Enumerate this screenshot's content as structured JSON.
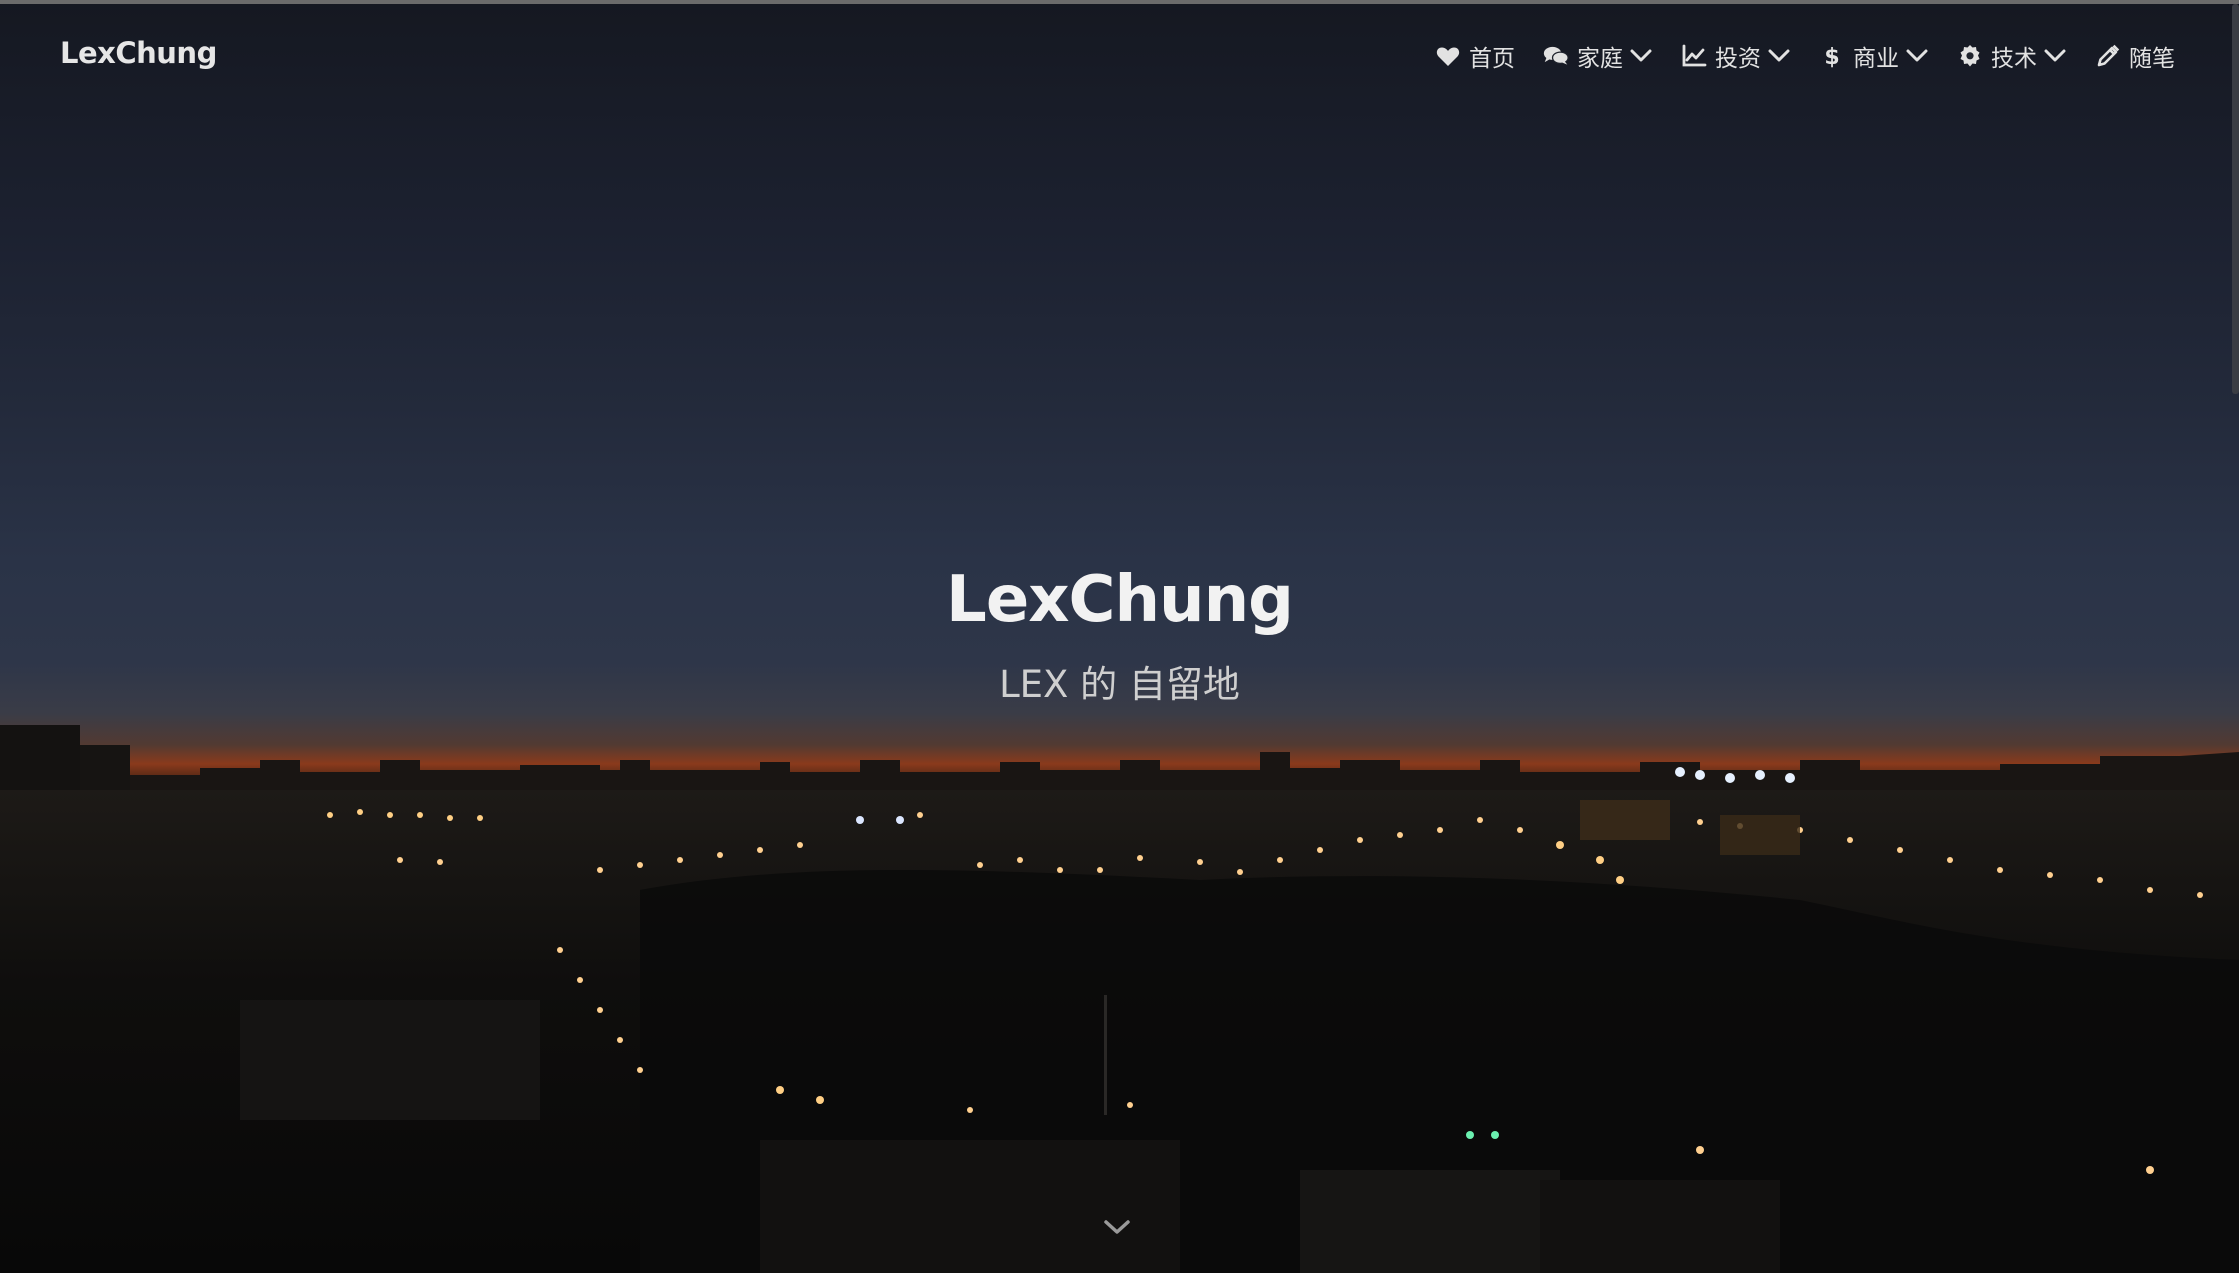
{
  "header": {
    "brand": "LexChung"
  },
  "nav": {
    "items": [
      {
        "label": "首页",
        "icon": "heart-icon",
        "has_dropdown": false
      },
      {
        "label": "家庭",
        "icon": "comments-icon",
        "has_dropdown": true
      },
      {
        "label": "投资",
        "icon": "line-chart-icon",
        "has_dropdown": true
      },
      {
        "label": "商业",
        "icon": "dollar-icon",
        "has_dropdown": true
      },
      {
        "label": "技术",
        "icon": "gear-icon",
        "has_dropdown": true
      },
      {
        "label": "随笔",
        "icon": "pencil-icon",
        "has_dropdown": false
      }
    ]
  },
  "hero": {
    "title": "LexChung",
    "subtitle": "LEX 的 自留地",
    "scroll_icon": "chevron-down-icon"
  },
  "colors": {
    "nav_text": "#e2e2e2",
    "title": "#f2f2f2",
    "horizon_glow": "#8a3a1c"
  }
}
